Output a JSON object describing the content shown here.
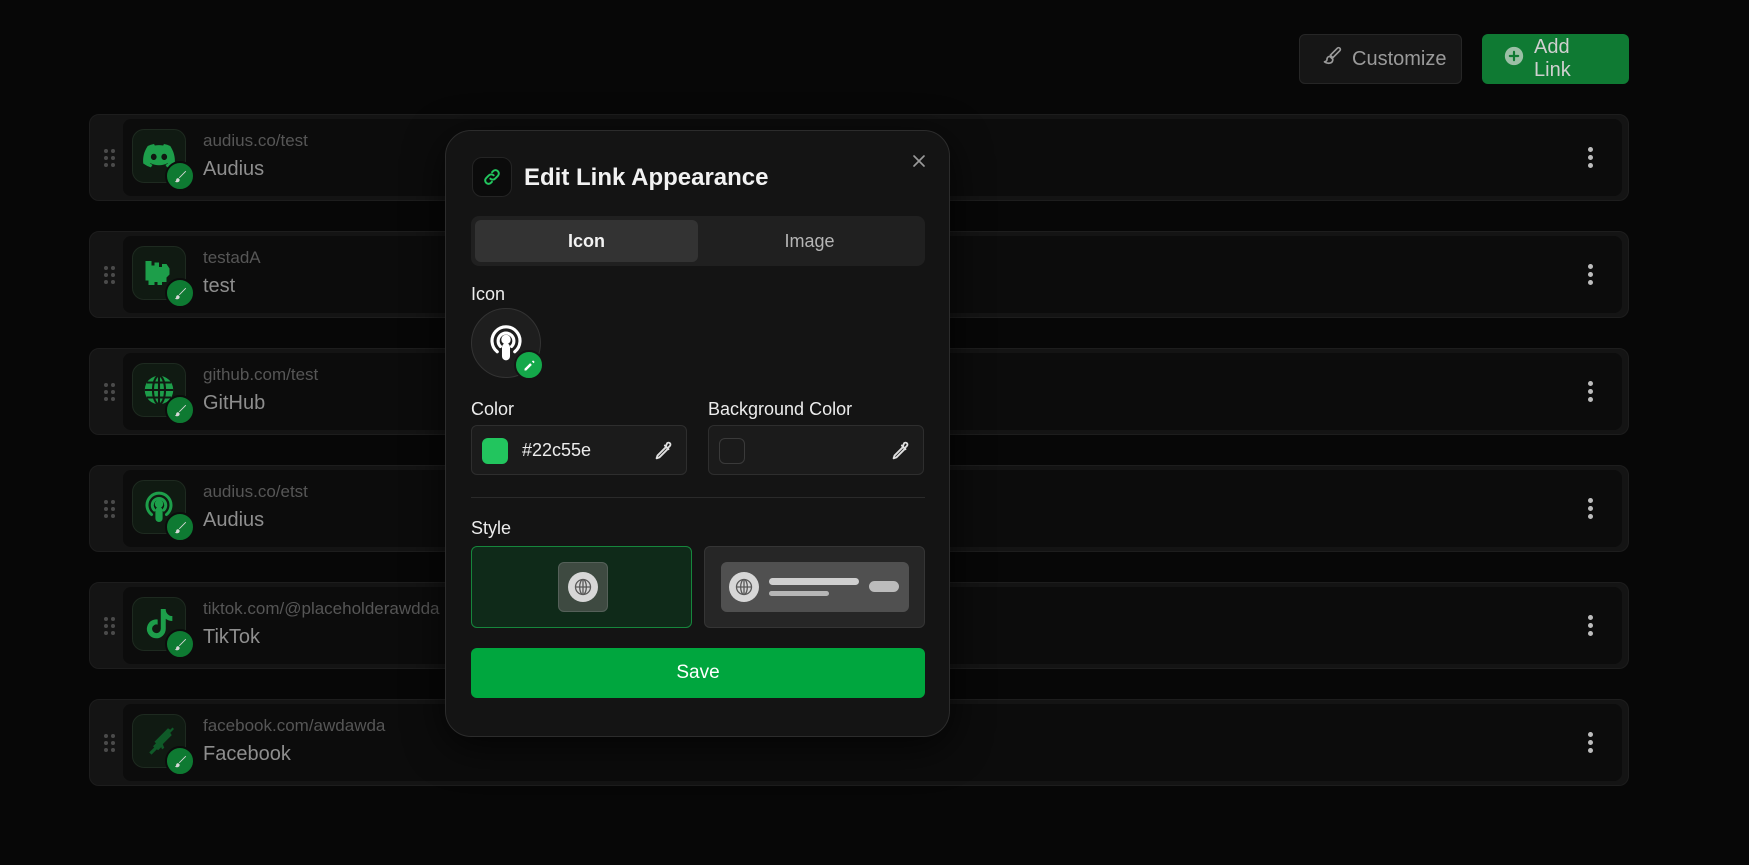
{
  "toolbar": {
    "customize_label": "Customize",
    "customize_icon": "paintbrush-icon",
    "add_link_label": "Add Link",
    "add_link_icon": "plus-circle-icon"
  },
  "links": [
    {
      "url": "audius.co/test",
      "title": "Audius",
      "icon": "discord-icon"
    },
    {
      "url": "testadA",
      "title": "test",
      "icon": "kick-icon"
    },
    {
      "url": "github.com/test",
      "title": "GitHub",
      "icon": "globe-icon"
    },
    {
      "url": "audius.co/etst",
      "title": "Audius",
      "icon": "podcast-icon"
    },
    {
      "url": "tiktok.com/@placeholderawdda",
      "title": "TikTok",
      "icon": "tiktok-icon"
    },
    {
      "url": "facebook.com/awdawda",
      "title": "Facebook",
      "icon": "rifle-icon"
    }
  ],
  "modal": {
    "title": "Edit Link Appearance",
    "header_icon": "link-icon",
    "tabs": [
      {
        "label": "Icon",
        "active": true
      },
      {
        "label": "Image",
        "active": false
      }
    ],
    "icon_label": "Icon",
    "selected_icon": "podcast-icon",
    "color_label": "Color",
    "color_value": "#22c55e",
    "background_color_label": "Background Color",
    "background_color_value": "",
    "style_label": "Style",
    "style_options": [
      {
        "name": "icon-only",
        "selected": true
      },
      {
        "name": "icon-with-text",
        "selected": false
      }
    ],
    "save_label": "Save"
  },
  "colors": {
    "accent": "#22c55e",
    "button_green": "#00a63e",
    "background": "#070707"
  }
}
